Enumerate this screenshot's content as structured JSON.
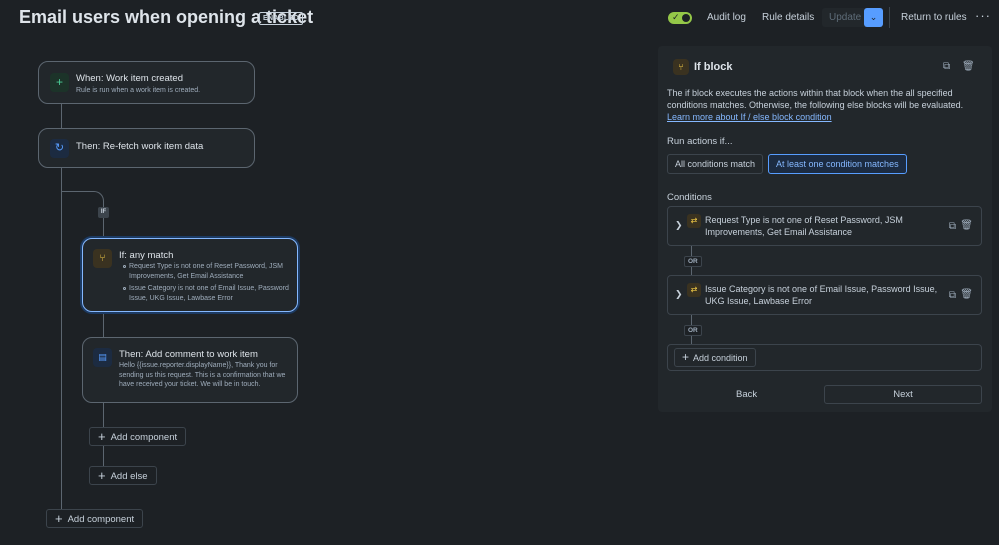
{
  "header": {
    "title": "Email users when opening a ticket",
    "status_badge": "ENABLED",
    "audit_log": "Audit log",
    "rule_details": "Rule details",
    "update": "Update",
    "return_to_rules": "Return to rules"
  },
  "flow": {
    "trigger": {
      "title": "When: Work item created",
      "subtitle": "Rule is run when a work item is created."
    },
    "refetch": {
      "title": "Then: Re-fetch work item data"
    },
    "if_badge": "IF",
    "if_block": {
      "title": "If: any match",
      "conditions": [
        "Request Type is not one of Reset Password, JSM Improvements, Get Email Assistance",
        "Issue Category is not one of Email Issue, Password Issue, UKG Issue, Lawbase Error"
      ]
    },
    "comment": {
      "title": "Then: Add comment to work item",
      "body": "Hello {{issue.reporter.displayName}}, Thank you for sending us this request. This is a confirmation that we have received your ticket. We will be in touch."
    },
    "add_component_inner": "Add component",
    "add_else": "Add else",
    "add_component_outer": "Add component"
  },
  "panel": {
    "title": "If block",
    "description": "The if block executes the actions within that block when the all specified conditions matches. Otherwise, the following else blocks will be evaluated.",
    "learn_more": "Learn more about If / else block condition",
    "run_actions_label": "Run actions if...",
    "options": [
      {
        "label": "All conditions match",
        "selected": false
      },
      {
        "label": "At least one condition matches",
        "selected": true
      }
    ],
    "conditions_label": "Conditions",
    "conditions": [
      "Request Type is not one of Reset Password, JSM Improvements, Get Email Assistance",
      "Issue Category is not one of Email Issue, Password Issue, UKG Issue, Lawbase Error"
    ],
    "or_label": "OR",
    "add_condition": "Add condition",
    "back": "Back",
    "next": "Next"
  },
  "colors": {
    "background": "#1d2125",
    "accent": "#579dff",
    "enabled_toggle": "#94c748"
  },
  "icons": {
    "trigger": "plus-icon",
    "refetch": "refresh-icon",
    "if": "branch-icon",
    "comment": "comment-icon",
    "condition": "swap-icon"
  }
}
